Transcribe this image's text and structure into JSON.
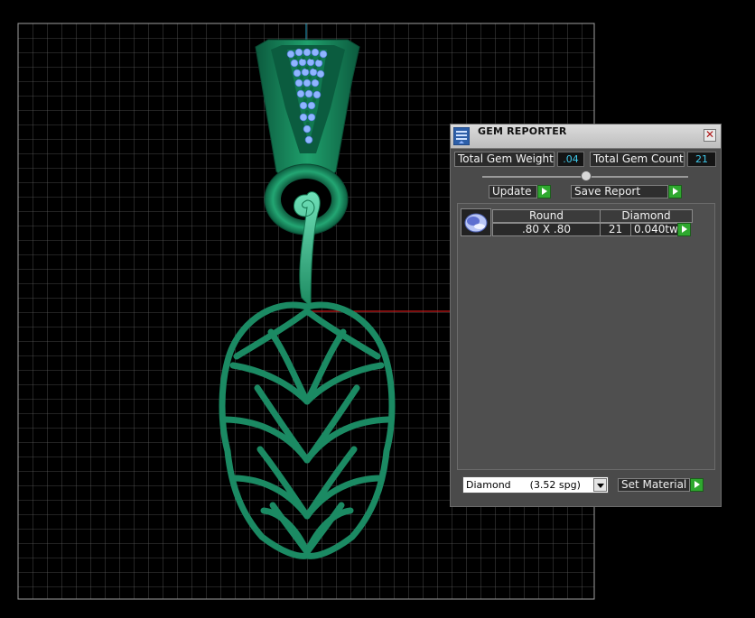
{
  "gem_reporter": {
    "title": "GEM REPORTER",
    "close_glyph": "✕",
    "total_gem_weight_label": "Total Gem Weight",
    "total_gem_weight_value": ".04",
    "total_gem_count_label": "Total Gem Count",
    "total_gem_count_value": "21",
    "update_label": "Update",
    "save_report_label": "Save Report",
    "table": {
      "headers": [
        "Round",
        "Diamond"
      ],
      "rows": [
        {
          "size": ".80 X .80",
          "count": "21",
          "weight": "0.040tw"
        }
      ]
    },
    "material_select_value": "Diamond      (3.52 spg)",
    "set_material_label": "Set Material"
  },
  "colors": {
    "grid_line": "#6a6a6a",
    "grid_border": "#9a9a9a",
    "pendant_dark": "#0f6b4a",
    "pendant_mid": "#1d9a6a",
    "pendant_light": "#58d1a6",
    "gem_blue": "#8fb5ff",
    "axis_red": "#c81818",
    "axis_cyan": "#2aa6c8",
    "accent_value": "#3fc7e8"
  }
}
